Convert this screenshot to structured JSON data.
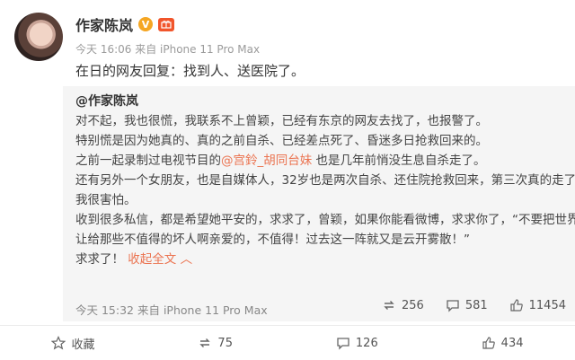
{
  "post": {
    "author": "作家陈岚",
    "badge_v": "V",
    "timestamp": "今天 16:06 来自 iPhone 11 Pro Max",
    "text": "在日的网友回复：找到人、送医院了。"
  },
  "quoted": {
    "author": "@作家陈岚",
    "lines": {
      "l1": "对不起，我也很慌，我联系不上曾颖，已经有东京的网友去找了，也报警了。",
      "l2": "特别慌是因为她真的、真的之前自杀、已经差点死了、昏迷多日抢救回来的。",
      "l3_pre": "之前一起录制过电视节目的",
      "l3_mention": "@宫鈴_胡同台妹",
      "l3_post": " 也是几年前悄没生息自杀走了。",
      "l4": "还有另外一个女朋友，也是自媒体人，32岁也是两次自杀、还住院抢救回来，第三次真的走了。",
      "l5": "我很害怕。",
      "l6": "收到很多私信，都是希望她平安的，求求了，曾颖，如果你能看微博，求求你了，“不要把世界",
      "l7": "让给那些不值得的坏人啊亲爱的，不值得！过去这一阵就又是云开雾散！”",
      "l8_pre": "求求了！ ",
      "l8_link": "收起全文 ︿"
    },
    "timestamp": "今天 15:32 来自 iPhone 11 Pro Max",
    "stats": {
      "reposts": "256",
      "comments": "581",
      "likes": "11454"
    }
  },
  "toolbar": {
    "favorite": "收藏",
    "repost": "75",
    "comment": "126",
    "like": "434"
  },
  "colors": {
    "accent": "#eb7350",
    "verified": "#f5a623"
  },
  "icons": [
    "verified-v-icon",
    "gift-badge-icon",
    "repost-icon",
    "comment-icon",
    "like-icon",
    "star-icon"
  ]
}
